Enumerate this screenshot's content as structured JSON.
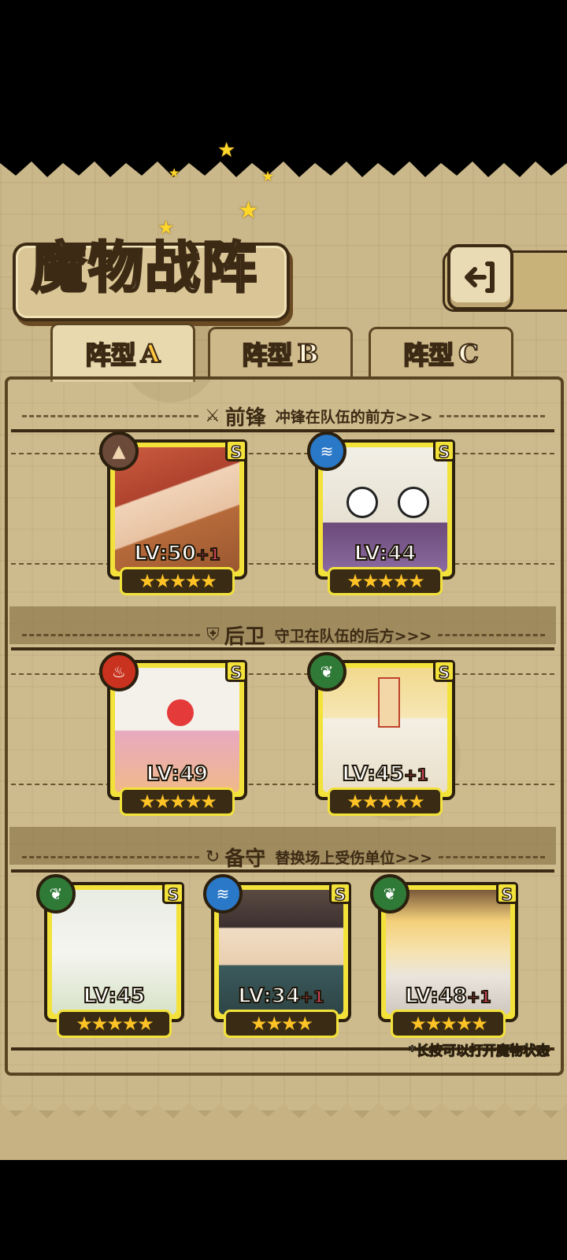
{
  "title": "魔物战阵",
  "tabs": [
    {
      "label": "阵型",
      "letter": "A",
      "active": true
    },
    {
      "label": "阵型",
      "letter": "B",
      "active": false
    },
    {
      "label": "阵型",
      "letter": "C",
      "active": false
    }
  ],
  "sections": {
    "front": {
      "name": "前锋",
      "desc": "冲锋在队伍的前方>>>"
    },
    "rear": {
      "name": "后卫",
      "desc": "守卫在队伍的后方>>>"
    },
    "reserve": {
      "name": "备守",
      "desc": "替换场上受伤单位>>>"
    }
  },
  "cards": [
    {
      "lv": "LV:50",
      "plus": "+1",
      "rank": "S",
      "element": "earth",
      "element_color": "#6b4a3a",
      "stars": "★★★★★"
    },
    {
      "lv": "LV:44",
      "plus": "",
      "rank": "S",
      "element": "water",
      "element_color": "#2a78c8",
      "stars": "★★★★★"
    },
    {
      "lv": "LV:49",
      "plus": "",
      "rank": "S",
      "element": "fire",
      "element_color": "#c8321e",
      "stars": "★★★★★"
    },
    {
      "lv": "LV:45",
      "plus": "+1",
      "rank": "S",
      "element": "wood",
      "element_color": "#2f7a36",
      "stars": "★★★★★"
    },
    {
      "lv": "LV:45",
      "plus": "",
      "rank": "S",
      "element": "wood",
      "element_color": "#2f7a36",
      "stars": "★★★★★"
    },
    {
      "lv": "LV:34",
      "plus": "+1",
      "rank": "S",
      "element": "water",
      "element_color": "#2a78c8",
      "stars": "★★★★"
    },
    {
      "lv": "LV:48",
      "plus": "+1",
      "rank": "S",
      "element": "wood",
      "element_color": "#2f7a36",
      "stars": "★★★★★"
    }
  ],
  "hint": "*长按可以打开魔物状态"
}
